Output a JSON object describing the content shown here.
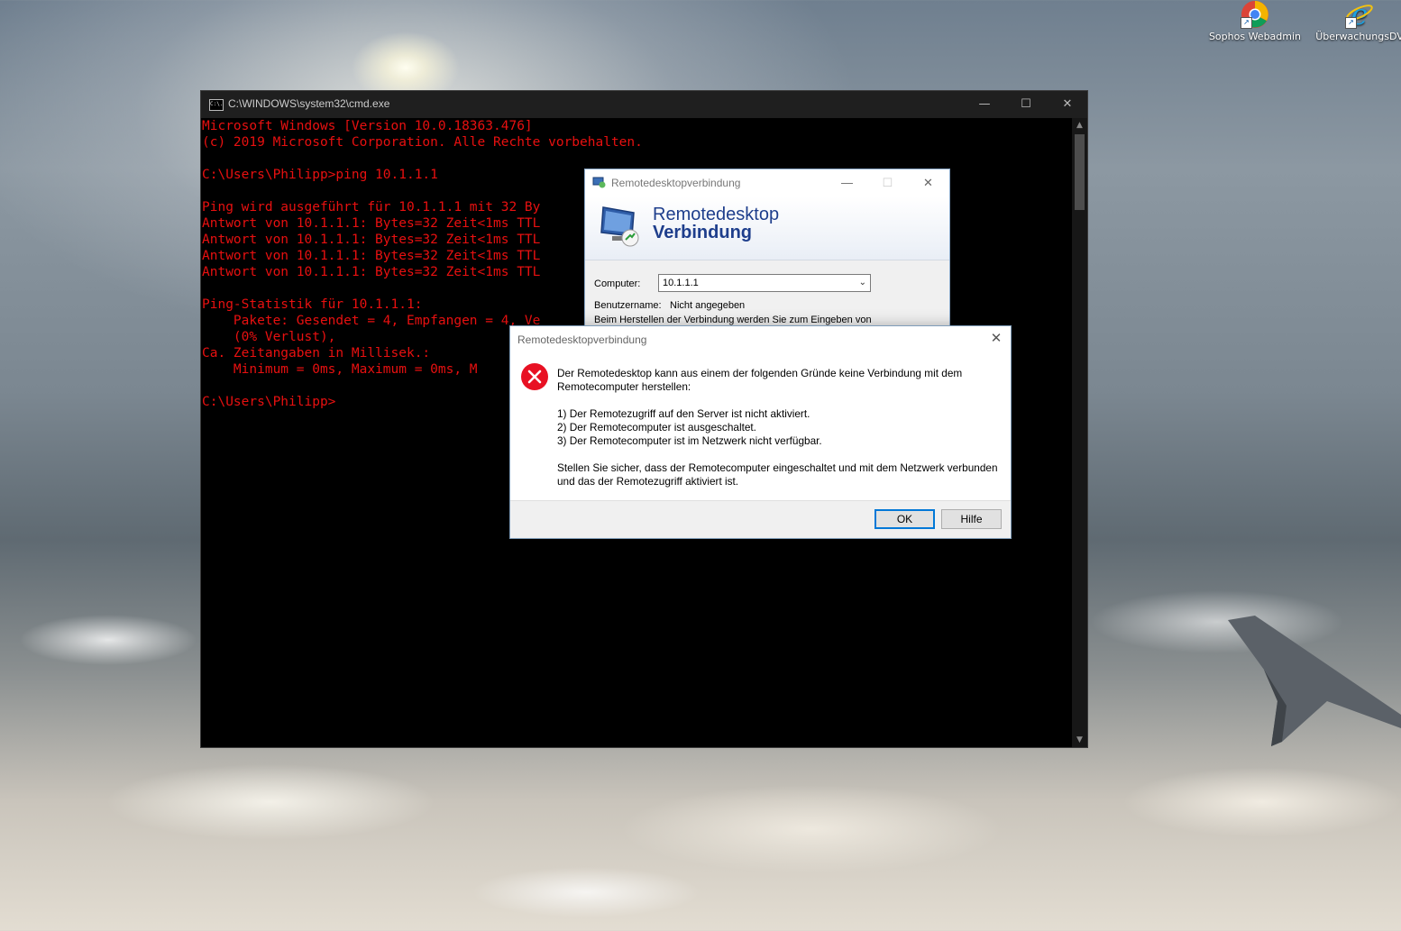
{
  "desktop": {
    "icons": [
      {
        "label": "Sophos Webadmin",
        "icon": "chrome-icon"
      },
      {
        "label": "ÜberwachungsDV",
        "icon": "internet-explorer-icon"
      }
    ]
  },
  "cmd": {
    "title": "C:\\WINDOWS\\system32\\cmd.exe",
    "icon_text": "C:\\.",
    "text_color": "#e81010",
    "lines": [
      "Microsoft Windows [Version 10.0.18363.476]",
      "(c) 2019 Microsoft Corporation. Alle Rechte vorbehalten.",
      "",
      "C:\\Users\\Philipp>ping 10.1.1.1",
      "",
      "Ping wird ausgeführt für 10.1.1.1 mit 32 By",
      "Antwort von 10.1.1.1: Bytes=32 Zeit<1ms TTL",
      "Antwort von 10.1.1.1: Bytes=32 Zeit<1ms TTL",
      "Antwort von 10.1.1.1: Bytes=32 Zeit<1ms TTL",
      "Antwort von 10.1.1.1: Bytes=32 Zeit<1ms TTL",
      "",
      "Ping-Statistik für 10.1.1.1:",
      "    Pakete: Gesendet = 4, Empfangen = 4, Ve",
      "    (0% Verlust),",
      "Ca. Zeitangaben in Millisek.:",
      "    Minimum = 0ms, Maximum = 0ms, M",
      "",
      "C:\\Users\\Philipp>"
    ],
    "controls": {
      "minimize": "—",
      "maximize": "☐",
      "close": "✕"
    }
  },
  "rdp": {
    "title": "Remotedesktopverbindung",
    "banner_line1": "Remotedesktop",
    "banner_line2": "Verbindung",
    "computer_label": "Computer:",
    "computer_value": "10.1.1.1",
    "username_label": "Benutzername:",
    "username_value": "Nicht angegeben",
    "info_text": "Beim Herstellen der Verbindung werden Sie zum Eingeben von",
    "controls": {
      "minimize": "—",
      "maximize": "☐",
      "close": "✕"
    }
  },
  "error_dialog": {
    "title": "Remotedesktopverbindung",
    "close": "✕",
    "message_intro_1": "Der Remotedesktop kann aus einem der folgenden Gründe keine Verbindung mit dem",
    "message_intro_2": "Remotecomputer herstellen:",
    "reasons": [
      "1) Der Remotezugriff auf den Server ist nicht aktiviert.",
      "2) Der Remotecomputer ist ausgeschaltet.",
      "3) Der Remotecomputer ist im Netzwerk nicht verfügbar."
    ],
    "advice_1": "Stellen Sie sicher, dass der Remotecomputer eingeschaltet und mit dem Netzwerk verbunden",
    "advice_2": "und das der Remotezugriff aktiviert ist.",
    "ok_label": "OK",
    "help_label": "Hilfe",
    "accent": "#0078d7",
    "error_color": "#e81123"
  }
}
